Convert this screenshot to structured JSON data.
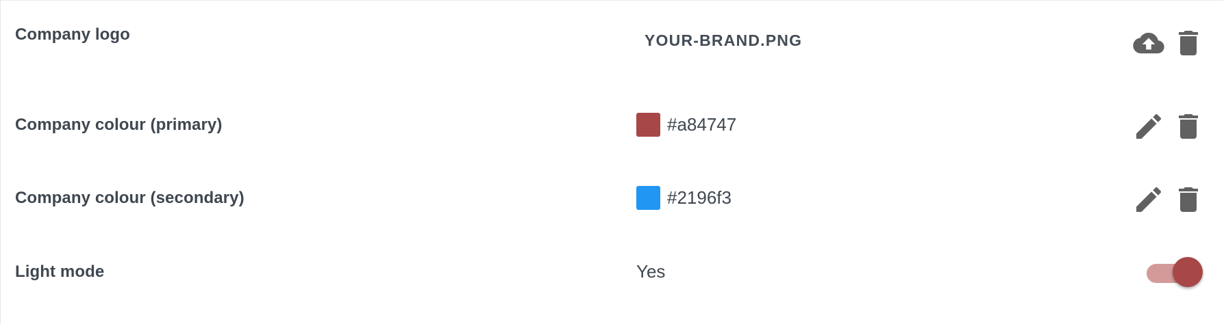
{
  "colors": {
    "icon": "#616161",
    "primary": "#a84747",
    "secondary": "#2196f3",
    "toggle_track": "#d49a9a",
    "toggle_thumb": "#a84747"
  },
  "settings": {
    "logo": {
      "label": "Company logo",
      "value": "YOUR-BRAND.PNG",
      "icons": [
        "cloud-upload-icon",
        "trash-icon"
      ]
    },
    "primary_colour": {
      "label": "Company colour (primary)",
      "value": "#a84747",
      "icons": [
        "pencil-icon",
        "trash-icon"
      ]
    },
    "secondary_colour": {
      "label": "Company colour (secondary)",
      "value": "#2196f3",
      "icons": [
        "pencil-icon",
        "trash-icon"
      ]
    },
    "light_mode": {
      "label": "Light mode",
      "value": "Yes",
      "enabled": true
    }
  }
}
